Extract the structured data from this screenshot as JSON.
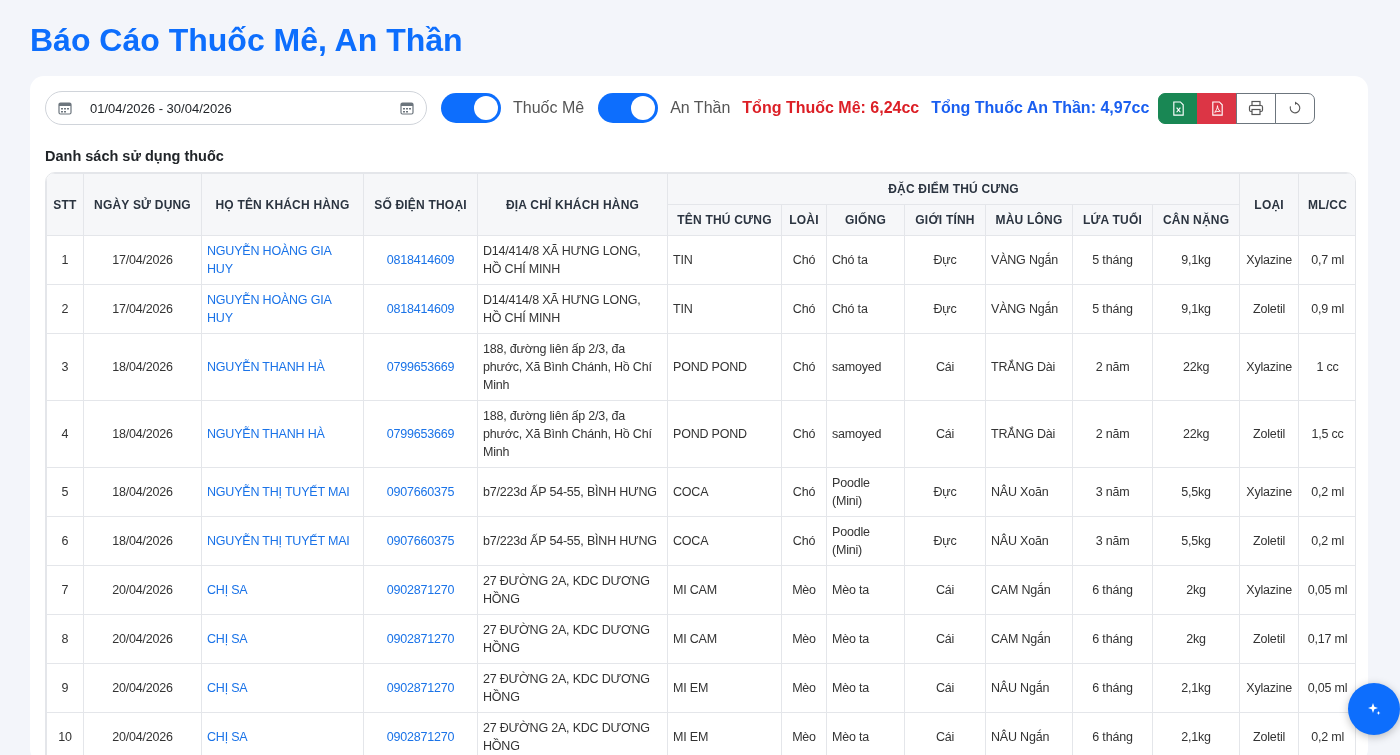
{
  "title": "Báo Cáo Thuốc Mê, An Thần",
  "date_range": {
    "value": "01/04/2026 - 30/04/2026"
  },
  "toggles": [
    {
      "label": "Thuốc Mê",
      "on": true
    },
    {
      "label": "An Thần",
      "on": true
    }
  ],
  "totals": [
    {
      "text": "Tổng Thuốc Mê: 6,24cc",
      "color": "#dc1f26"
    },
    {
      "text": "Tổng Thuốc An Thần: 4,97cc",
      "color": "#1a5ff0"
    }
  ],
  "toolbar_buttons": [
    {
      "kind": "excel"
    },
    {
      "kind": "pdf"
    },
    {
      "kind": "print"
    },
    {
      "kind": "refresh"
    }
  ],
  "section_title": "Danh sách sử dụng thuốc",
  "table": {
    "column_group_label": "ĐẶC ĐIỂM THÚ CƯNG",
    "columns": [
      {
        "label": "STT",
        "kind": "text",
        "in_group": false
      },
      {
        "label": "NGÀY SỬ DỤNG",
        "kind": "text",
        "in_group": false
      },
      {
        "label": "HỌ TÊN KHÁCH HÀNG",
        "kind": "link",
        "in_group": false
      },
      {
        "label": "SỐ ĐIỆN THOẠI",
        "kind": "link",
        "in_group": false
      },
      {
        "label": "ĐỊA CHỈ KHÁCH HÀNG",
        "kind": "text",
        "in_group": false
      },
      {
        "label": "TÊN THÚ CƯNG",
        "kind": "text",
        "in_group": true
      },
      {
        "label": "LOÀI",
        "kind": "text",
        "in_group": true
      },
      {
        "label": "GIỐNG",
        "kind": "text",
        "in_group": true
      },
      {
        "label": "GIỚI TÍNH",
        "kind": "text",
        "in_group": true
      },
      {
        "label": "MÀU LÔNG",
        "kind": "text",
        "in_group": true
      },
      {
        "label": "LỨA TUỔI",
        "kind": "text",
        "in_group": true
      },
      {
        "label": "CÂN NẶNG",
        "kind": "text",
        "in_group": true
      },
      {
        "label": "LOẠI",
        "kind": "text",
        "in_group": false
      },
      {
        "label": "ML/CC",
        "kind": "text",
        "in_group": false
      }
    ],
    "rows": [
      [
        "1",
        "17/04/2026",
        "NGUYỄN HOÀNG GIA HUY",
        "0818414609",
        "D14/414/8 XÃ HƯNG LONG, HỒ CHÍ MINH",
        "TIN",
        "Chó",
        "Chó ta",
        "Đực",
        "VÀNG Ngắn",
        "5 tháng",
        "9,1kg",
        "Xylazine",
        "0,7 ml"
      ],
      [
        "2",
        "17/04/2026",
        "NGUYỄN HOÀNG GIA HUY",
        "0818414609",
        "D14/414/8 XÃ HƯNG LONG, HỒ CHÍ MINH",
        "TIN",
        "Chó",
        "Chó ta",
        "Đực",
        "VÀNG Ngắn",
        "5 tháng",
        "9,1kg",
        "Zoletil",
        "0,9 ml"
      ],
      [
        "3",
        "18/04/2026",
        "NGUYỄN THANH HÀ",
        "0799653669",
        "188, đường liên ấp 2/3, đa phước, Xã Bình Chánh, Hồ Chí Minh",
        "POND POND",
        "Chó",
        "samoyed",
        "Cái",
        "TRẮNG Dài",
        "2 năm",
        "22kg",
        "Xylazine",
        "1 cc"
      ],
      [
        "4",
        "18/04/2026",
        "NGUYỄN THANH HÀ",
        "0799653669",
        "188, đường liên ấp 2/3, đa phước, Xã Bình Chánh, Hồ Chí Minh",
        "POND POND",
        "Chó",
        "samoyed",
        "Cái",
        "TRẮNG Dài",
        "2 năm",
        "22kg",
        "Zoletil",
        "1,5 cc"
      ],
      [
        "5",
        "18/04/2026",
        "NGUYỄN THỊ TUYẾT MAI",
        "0907660375",
        "b7/223d ẤP 54-55, BÌNH HƯNG",
        "COCA",
        "Chó",
        "Poodle (Mini)",
        "Đực",
        "NÂU Xoăn",
        "3 năm",
        "5,5kg",
        "Xylazine",
        "0,2 ml"
      ],
      [
        "6",
        "18/04/2026",
        "NGUYỄN THỊ TUYẾT MAI",
        "0907660375",
        "b7/223d ẤP 54-55, BÌNH HƯNG",
        "COCA",
        "Chó",
        "Poodle (Mini)",
        "Đực",
        "NÂU Xoăn",
        "3 năm",
        "5,5kg",
        "Zoletil",
        "0,2 ml"
      ],
      [
        "7",
        "20/04/2026",
        "CHỊ SA",
        "0902871270",
        "27 ĐƯỜNG 2A, KDC DƯƠNG HỒNG",
        "MI CAM",
        "Mèo",
        "Mèo ta",
        "Cái",
        "CAM Ngắn",
        "6 tháng",
        "2kg",
        "Xylazine",
        "0,05 ml"
      ],
      [
        "8",
        "20/04/2026",
        "CHỊ SA",
        "0902871270",
        "27 ĐƯỜNG 2A, KDC DƯƠNG HỒNG",
        "MI CAM",
        "Mèo",
        "Mèo ta",
        "Cái",
        "CAM Ngắn",
        "6 tháng",
        "2kg",
        "Zoletil",
        "0,17 ml"
      ],
      [
        "9",
        "20/04/2026",
        "CHỊ SA",
        "0902871270",
        "27 ĐƯỜNG 2A, KDC DƯƠNG HỒNG",
        "MI EM",
        "Mèo",
        "Mèo ta",
        "Cái",
        "NÂU Ngắn",
        "6 tháng",
        "2,1kg",
        "Xylazine",
        "0,05 ml"
      ],
      [
        "10",
        "20/04/2026",
        "CHỊ SA",
        "0902871270",
        "27 ĐƯỜNG 2A, KDC DƯƠNG HỒNG",
        "MI EM",
        "Mèo",
        "Mèo ta",
        "Cái",
        "NÂU Ngắn",
        "6 tháng",
        "2,1kg",
        "Zoletil",
        "0,2 ml"
      ]
    ]
  }
}
